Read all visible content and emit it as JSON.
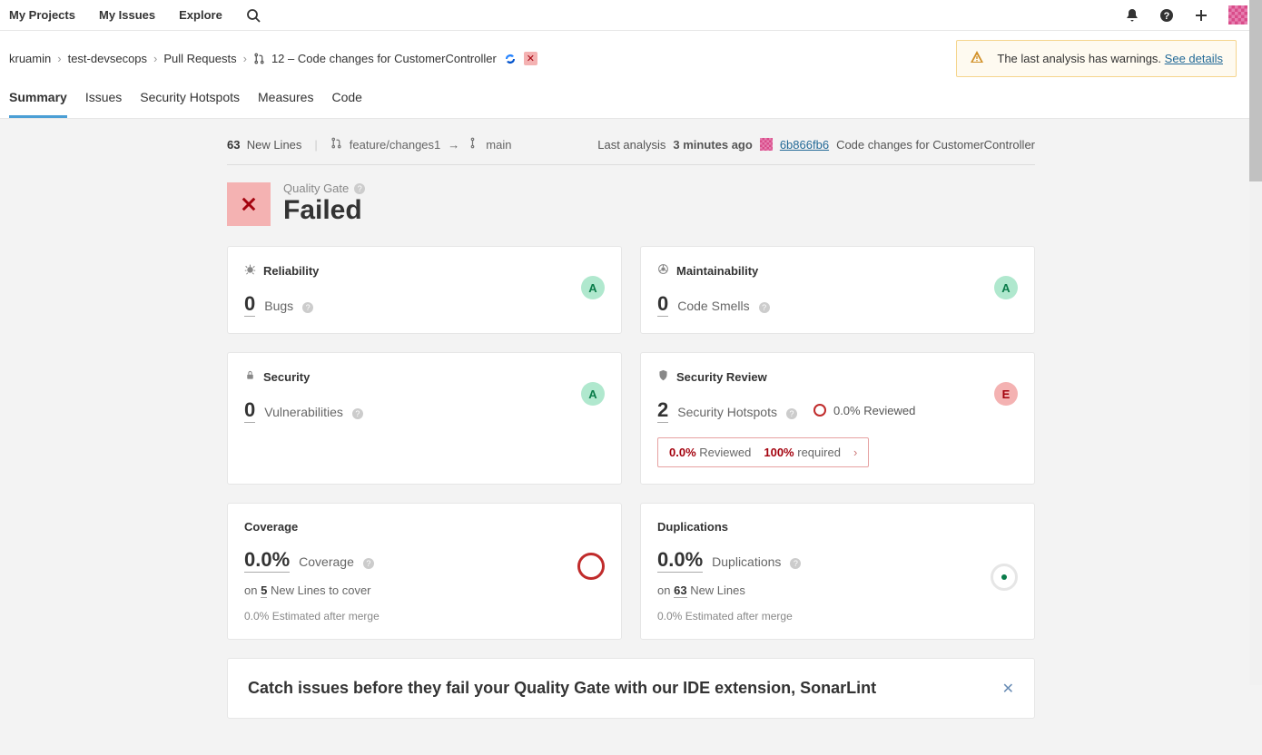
{
  "topnav": {
    "my_projects": "My Projects",
    "my_issues": "My Issues",
    "explore": "Explore"
  },
  "breadcrumb": {
    "org": "kruamin",
    "project": "test-devsecops",
    "section": "Pull Requests",
    "pr_number": "12",
    "pr_title": "Code changes for CustomerController"
  },
  "warning": {
    "text": "The last analysis has warnings.",
    "link": "See details"
  },
  "tabs": {
    "summary": "Summary",
    "issues": "Issues",
    "hotspots": "Security Hotspots",
    "measures": "Measures",
    "code": "Code"
  },
  "summary_bar": {
    "new_lines_count": "63",
    "new_lines_label": "New Lines",
    "source_branch": "feature/changes1",
    "target_branch": "main",
    "last_analysis_label": "Last analysis",
    "last_analysis_time": "3 minutes ago",
    "commit": "6b866fb6",
    "commit_msg": "Code changes for CustomerController"
  },
  "quality_gate": {
    "label": "Quality Gate",
    "status": "Failed"
  },
  "cards": {
    "reliability": {
      "title": "Reliability",
      "value": "0",
      "label": "Bugs",
      "rating": "A"
    },
    "maintainability": {
      "title": "Maintainability",
      "value": "0",
      "label": "Code Smells",
      "rating": "A"
    },
    "security": {
      "title": "Security",
      "value": "0",
      "label": "Vulnerabilities",
      "rating": "A"
    },
    "security_review": {
      "title": "Security Review",
      "value": "2",
      "label": "Security Hotspots",
      "reviewed": "0.0% Reviewed",
      "rating": "E",
      "req_reviewed_pct": "0.0%",
      "req_reviewed_lbl": "Reviewed",
      "req_required_pct": "100%",
      "req_required_lbl": "required"
    },
    "coverage": {
      "title": "Coverage",
      "value": "0.0%",
      "label": "Coverage",
      "on_prefix": "on",
      "on_count": "5",
      "on_suffix": "New Lines to cover",
      "estimated_pct": "0.0%",
      "estimated_lbl": "Estimated after merge"
    },
    "duplications": {
      "title": "Duplications",
      "value": "0.0%",
      "label": "Duplications",
      "on_prefix": "on",
      "on_count": "63",
      "on_suffix": "New Lines",
      "estimated_pct": "0.0%",
      "estimated_lbl": "Estimated after merge"
    }
  },
  "promo": {
    "text": "Catch issues before they fail your Quality Gate with our IDE extension, SonarLint"
  }
}
